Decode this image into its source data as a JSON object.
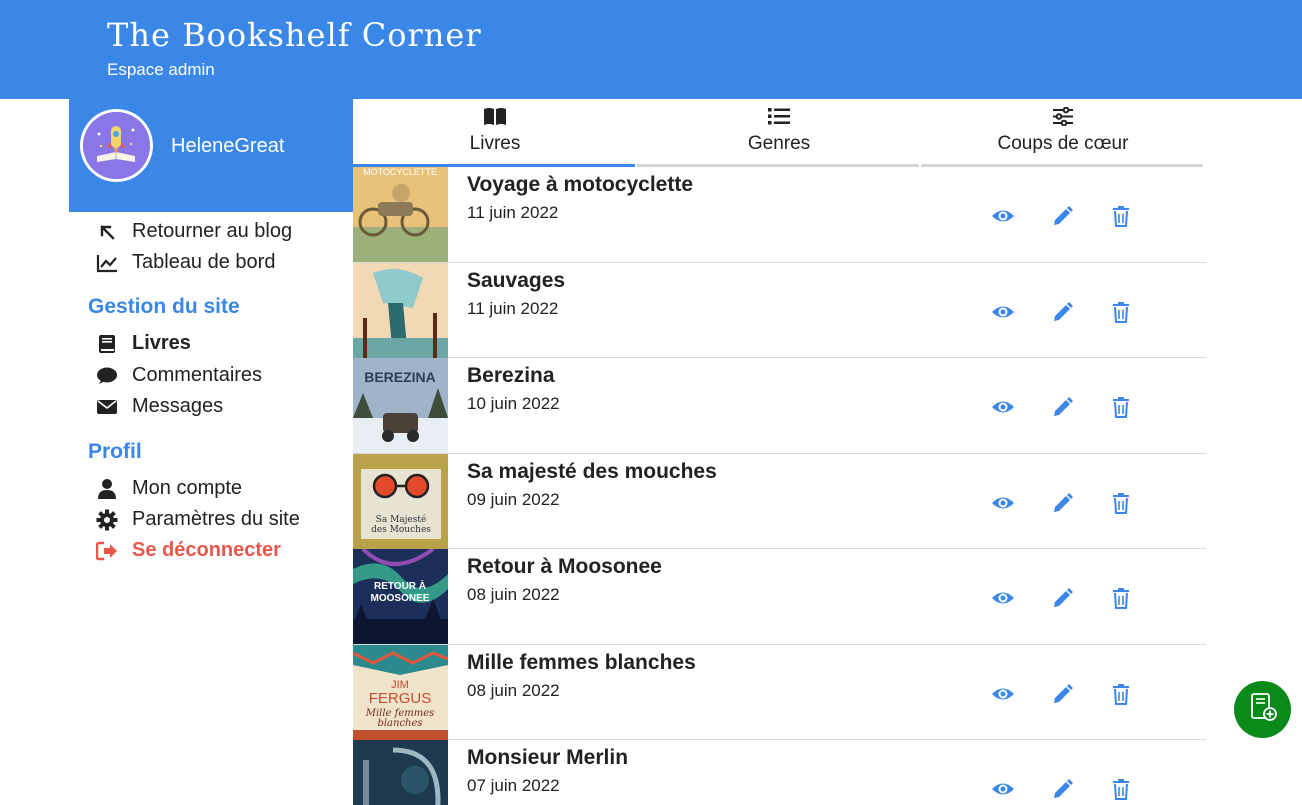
{
  "header": {
    "brand": "The Bookshelf Corner",
    "subtitle": "Espace admin"
  },
  "profile": {
    "username": "HeleneGreat"
  },
  "nav": {
    "back_to_blog": "Retourner au blog",
    "dashboard": "Tableau de bord",
    "site_section": "Gestion du site",
    "books": "Livres",
    "comments": "Commentaires",
    "messages": "Messages",
    "profile_section": "Profil",
    "account": "Mon compte",
    "settings": "Paramètres du site",
    "logout": "Se déconnecter"
  },
  "tabs": [
    {
      "label": "Livres",
      "icon": "book-open-icon",
      "active": true
    },
    {
      "label": "Genres",
      "icon": "list-icon",
      "active": false
    },
    {
      "label": "Coups de cœur",
      "icon": "sliders-icon",
      "active": false
    }
  ],
  "books": [
    {
      "title": "Voyage à motocyclette",
      "date": "11 juin 2022",
      "cover_color": "#e9c27a"
    },
    {
      "title": "Sauvages",
      "date": "11 juin 2022",
      "cover_color": "#f3d9b3"
    },
    {
      "title": "Berezina",
      "date": "10 juin 2022",
      "cover_color": "#9fb4c9"
    },
    {
      "title": "Sa majesté des mouches",
      "date": "09 juin 2022",
      "cover_color": "#b9a24a"
    },
    {
      "title": "Retour à Moosonee",
      "date": "08 juin 2022",
      "cover_color": "#2e6aa6"
    },
    {
      "title": "Mille femmes blanches",
      "date": "08 juin 2022",
      "cover_color": "#efe3cc"
    },
    {
      "title": "Monsieur Merlin",
      "date": "07 juin 2022",
      "cover_color": "#1d3a4e"
    }
  ],
  "colors": {
    "primary": "#3a87e8",
    "logout": "#e8574a",
    "fab": "#0a8a1a"
  }
}
